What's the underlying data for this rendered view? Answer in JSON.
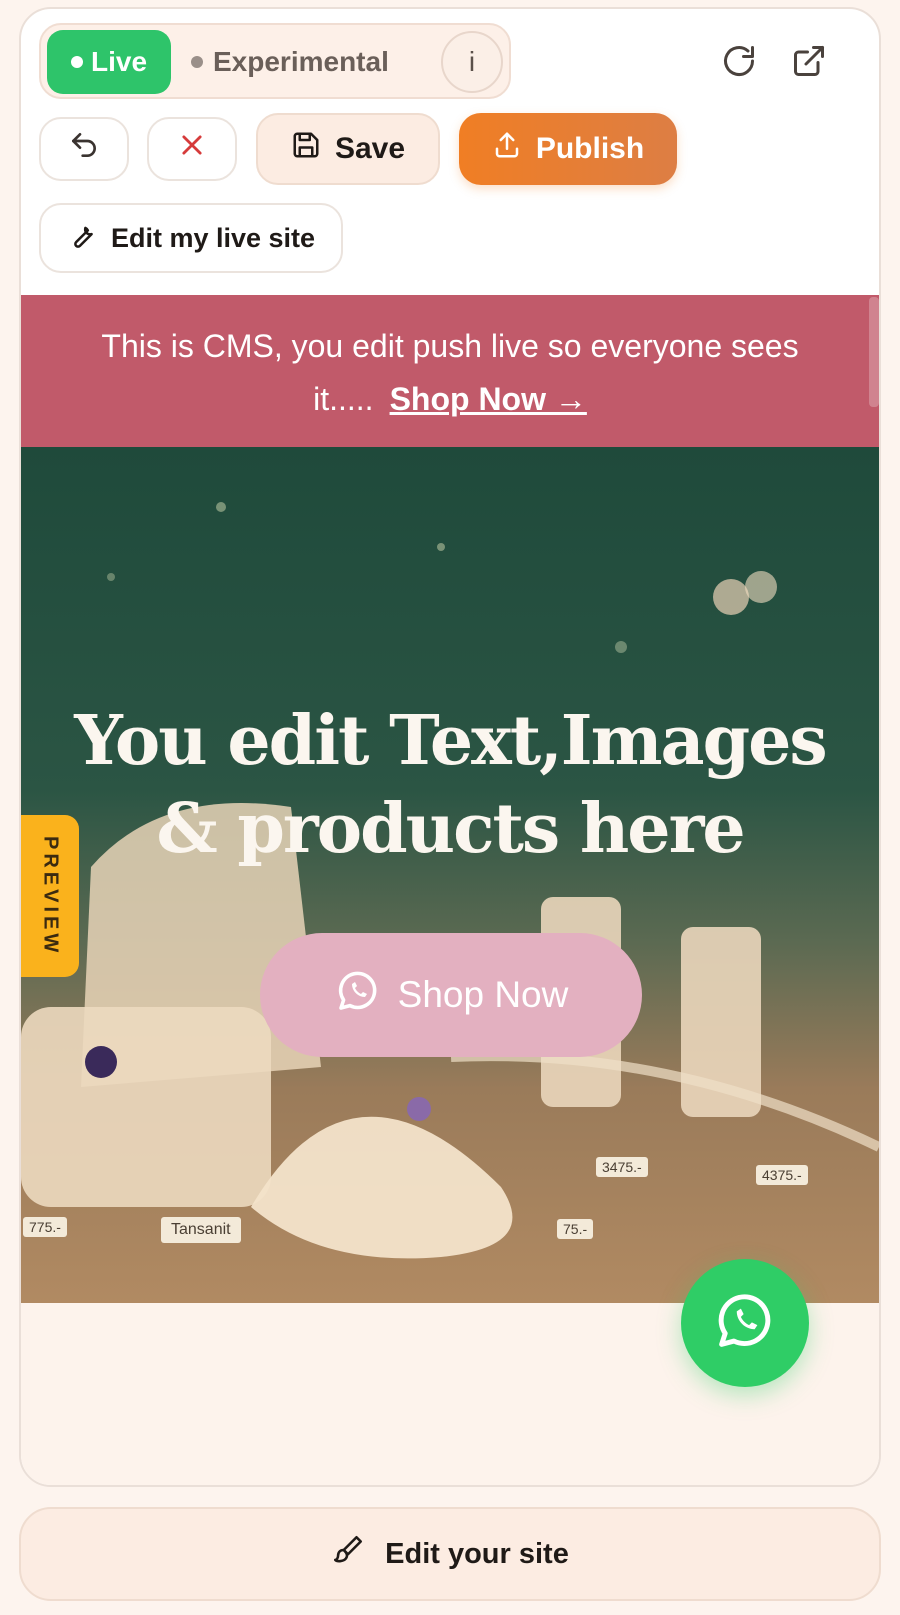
{
  "toolbar": {
    "modes": {
      "live_label": "Live",
      "experimental_label": "Experimental",
      "info_label": "i"
    },
    "save_label": "Save",
    "publish_label": "Publish",
    "edit_live_label": "Edit my live site",
    "icons": [
      "undo-icon",
      "close-icon",
      "save-icon",
      "upload-icon",
      "wrench-icon",
      "refresh-icon",
      "external-link-icon"
    ]
  },
  "preview": {
    "banner": {
      "text": "This is CMS, you edit push live so everyone sees it.....",
      "link_label": "Shop Now →"
    },
    "hero": {
      "title_line1": "You edit Text,Images",
      "title_line2": "& products here",
      "cta_label": "Shop Now"
    },
    "side_tab_label": "PREVIEW",
    "image_tags": {
      "tag1": "Tansanit",
      "tag2": "3475.-",
      "tag3": "4375.-",
      "tag4": "775.-",
      "tag5": "75.-"
    }
  },
  "footer": {
    "edit_site_label": "Edit your site"
  },
  "colors": {
    "live": "#2ec46a",
    "publish": "#f07e24",
    "banner": "#c15a6a",
    "cta": "#e3b0c0",
    "whatsapp": "#2fcd66",
    "preview_tab": "#fab21c",
    "page_bg": "#fdf4ee"
  }
}
